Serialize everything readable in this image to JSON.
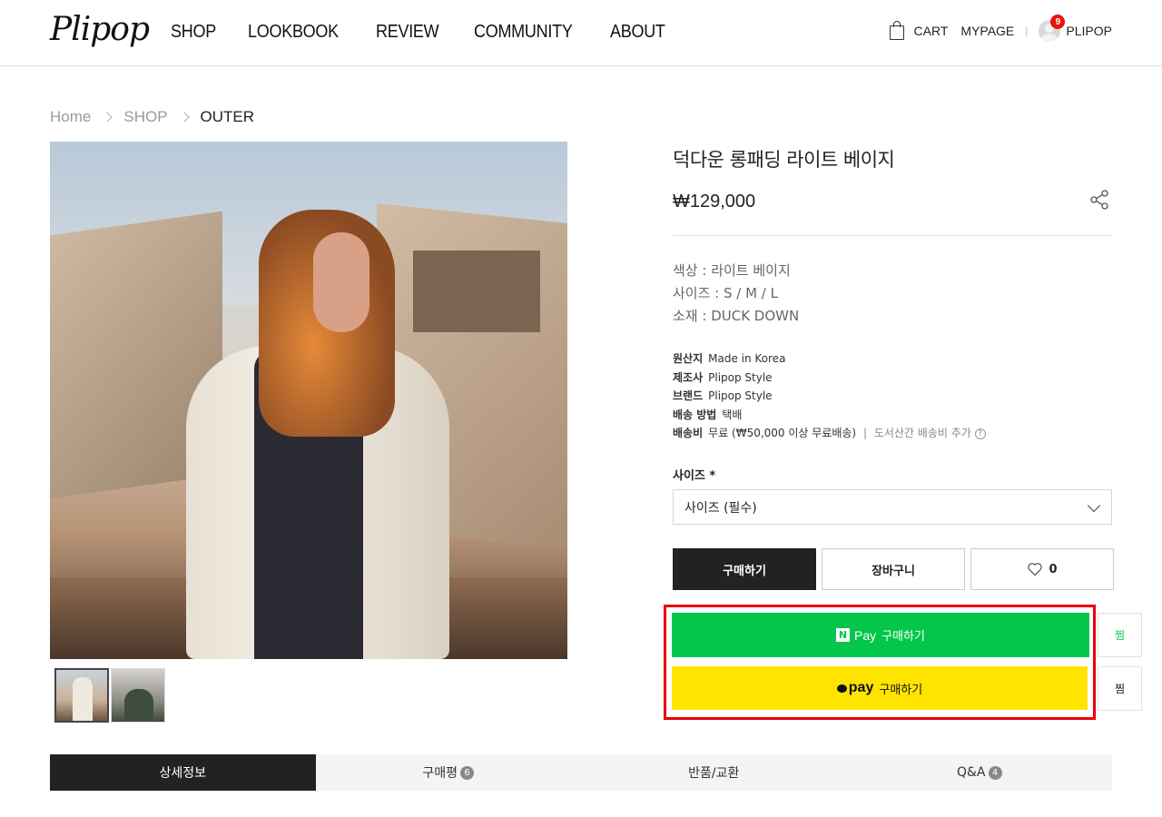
{
  "header": {
    "logo": "Plipop",
    "nav": [
      "SHOP",
      "LOOKBOOK",
      "REVIEW",
      "COMMUNITY",
      "ABOUT"
    ],
    "cart": "CART",
    "mypage": "MYPAGE",
    "separator": "|",
    "user": "PLIPOP",
    "notification_count": "9"
  },
  "breadcrumb": [
    "Home",
    "SHOP",
    "OUTER"
  ],
  "product": {
    "title": "덕다운 롱패딩 라이트 베이지",
    "price": "₩129,000",
    "attributes": [
      "색상 : 라이트 베이지",
      "사이즈 : S / M / L",
      "소재 : DUCK DOWN"
    ],
    "specs": [
      {
        "key": "원산지",
        "value": "Made in Korea"
      },
      {
        "key": "제조사",
        "value": "Plipop Style"
      },
      {
        "key": "브랜드",
        "value": "Plipop Style"
      },
      {
        "key": "배송 방법",
        "value": "택배"
      },
      {
        "key": "배송비",
        "value": "무료 (₩50,000 이상 무료배송)",
        "extra_sep": "|",
        "extra": "도서산간 배송비 추가",
        "help": "?"
      }
    ],
    "option_label": "사이즈 *",
    "option_selected": "사이즈 (필수)"
  },
  "actions": {
    "buy": "구매하기",
    "cart": "장바구니",
    "like_count": "0"
  },
  "pay": {
    "npay_logo": "N",
    "npay_word": "Pay",
    "npay_label": "구매하기",
    "kpay_word": "pay",
    "kpay_label": "구매하기",
    "zzim": "찜"
  },
  "tabs": [
    {
      "label": "상세정보",
      "count": ""
    },
    {
      "label": "구매평",
      "count": "6"
    },
    {
      "label": "반품/교환",
      "count": ""
    },
    {
      "label": "Q&A",
      "count": "4"
    }
  ],
  "colors": {
    "npay": "#03c64b",
    "kpay": "#ffe400",
    "highlight": "#e8000b",
    "dark": "#222222",
    "badge": "#e8140f"
  }
}
